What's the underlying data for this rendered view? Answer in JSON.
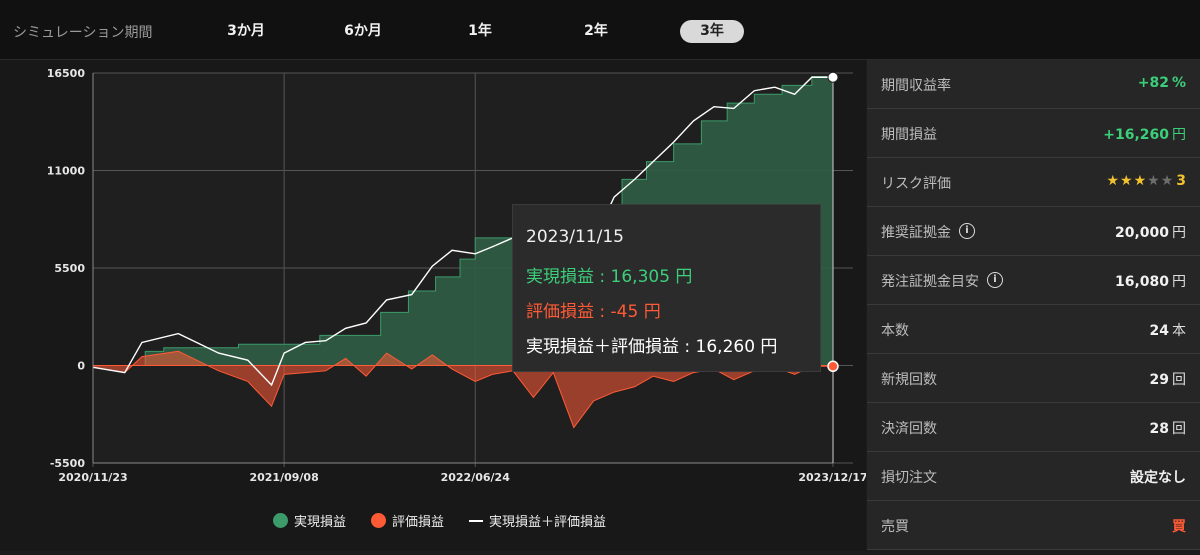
{
  "period": {
    "label": "シミュレーション期間",
    "options": [
      {
        "label": "3か月",
        "active": false
      },
      {
        "label": "6か月",
        "active": false
      },
      {
        "label": "1年",
        "active": false
      },
      {
        "label": "2年",
        "active": false
      },
      {
        "label": "3年",
        "active": true
      }
    ]
  },
  "stats": {
    "return_rate": {
      "label": "期間収益率",
      "value": "+82",
      "unit": "%"
    },
    "profit": {
      "label": "期間損益",
      "value": "+16,260",
      "unit": "円"
    },
    "risk": {
      "label": "リスク評価",
      "stars_on": 3,
      "stars_total": 5,
      "value": "3"
    },
    "recommended_margin": {
      "label": "推奨証拠金",
      "value": "20,000",
      "unit": "円"
    },
    "order_margin": {
      "label": "発注証拠金目安",
      "value": "16,080",
      "unit": "円"
    },
    "count": {
      "label": "本数",
      "value": "24",
      "unit": "本"
    },
    "new_orders": {
      "label": "新規回数",
      "value": "29",
      "unit": "回"
    },
    "settlements": {
      "label": "決済回数",
      "value": "28",
      "unit": "回"
    },
    "stop_loss": {
      "label": "損切注文",
      "value": "設定なし"
    },
    "side": {
      "label": "売買",
      "value": "買"
    }
  },
  "tooltip": {
    "date": "2023/11/15",
    "realized": "実現損益 : 16,305 円",
    "unrealized": "評価損益 : -45 円",
    "total": "実現損益＋評価損益 : 16,260 円"
  },
  "legend": {
    "realized": "実現損益",
    "unrealized": "評価損益",
    "total": "実現損益＋評価損益"
  },
  "colors": {
    "realized": "#3d9a6a",
    "realized_fill": "#2f5d45",
    "unrealized": "#ff5a36",
    "total": "#ffffff",
    "positive": "#3ccf7a",
    "negative": "#ff5a36"
  },
  "chart_data": {
    "type": "area",
    "ylim": [
      -5500,
      16500
    ],
    "yticks": [
      -5500,
      0,
      5500,
      11000,
      16500
    ],
    "ytick_labels": [
      "-5500",
      "0",
      "5500",
      "11000",
      "16500"
    ],
    "xtick_labels": [
      "2020/11/23",
      "2021/09/08",
      "2022/06/24",
      "2023/12/17"
    ],
    "xlim": [
      "2020/11/23",
      "2023/12/17"
    ],
    "grid": true,
    "series": [
      {
        "name": "実現損益",
        "x": [
          "2020/11/23",
          "2021/01/15",
          "2021/02/10",
          "2021/03/10",
          "2021/05/01",
          "2021/07/01",
          "2021/09/08",
          "2021/11/01",
          "2021/12/20",
          "2022/02/01",
          "2022/03/15",
          "2022/04/25",
          "2022/06/01",
          "2022/06/24",
          "2022/07/20",
          "2022/09/10",
          "2022/11/01",
          "2022/12/20",
          "2023/02/01",
          "2023/03/10",
          "2023/04/20",
          "2023/06/01",
          "2023/07/10",
          "2023/08/20",
          "2023/10/01",
          "2023/11/15",
          "2023/12/17"
        ],
        "values": [
          0,
          0,
          800,
          1000,
          1000,
          1200,
          1200,
          1700,
          1700,
          3000,
          4200,
          5000,
          6000,
          7200,
          7200,
          7500,
          8500,
          9000,
          10500,
          11500,
          12500,
          13800,
          14800,
          15300,
          15800,
          16305,
          16305
        ]
      },
      {
        "name": "評価損益",
        "x": [
          "2020/11/23",
          "2021/01/10",
          "2021/02/05",
          "2021/04/01",
          "2021/06/01",
          "2021/07/15",
          "2021/08/20",
          "2021/09/08",
          "2021/10/10",
          "2021/11/10",
          "2021/12/10",
          "2022/01/10",
          "2022/02/10",
          "2022/03/20",
          "2022/04/20",
          "2022/05/20",
          "2022/06/24",
          "2022/07/20",
          "2022/08/20",
          "2022/09/20",
          "2022/10/20",
          "2022/11/20",
          "2022/12/20",
          "2023/01/20",
          "2023/02/20",
          "2023/03/20",
          "2023/04/20",
          "2023/05/20",
          "2023/06/20",
          "2023/07/20",
          "2023/08/20",
          "2023/09/20",
          "2023/10/20",
          "2023/11/15",
          "2023/12/17"
        ],
        "values": [
          -100,
          -400,
          500,
          800,
          -300,
          -900,
          -2300,
          -500,
          -400,
          -300,
          400,
          -600,
          700,
          -200,
          600,
          -200,
          -900,
          -500,
          -300,
          -1800,
          -400,
          -3500,
          -2000,
          -1500,
          -1200,
          -600,
          -900,
          -400,
          -200,
          -800,
          -300,
          -100,
          -500,
          -45,
          -45
        ]
      },
      {
        "name": "実現損益＋評価損益",
        "x": [
          "2020/11/23",
          "2021/01/10",
          "2021/02/05",
          "2021/04/01",
          "2021/06/01",
          "2021/07/15",
          "2021/08/20",
          "2021/09/08",
          "2021/10/10",
          "2021/11/10",
          "2021/12/10",
          "2022/01/10",
          "2022/02/10",
          "2022/03/20",
          "2022/04/20",
          "2022/05/20",
          "2022/06/24",
          "2022/07/20",
          "2022/08/20",
          "2022/09/20",
          "2022/10/20",
          "2022/11/20",
          "2022/12/20",
          "2023/01/20",
          "2023/02/20",
          "2023/03/20",
          "2023/04/20",
          "2023/05/20",
          "2023/06/20",
          "2023/07/20",
          "2023/08/20",
          "2023/09/20",
          "2023/10/20",
          "2023/11/15",
          "2023/12/17"
        ],
        "values": [
          -100,
          -400,
          1300,
          1800,
          700,
          300,
          -1100,
          700,
          1300,
          1400,
          2100,
          2400,
          3700,
          4000,
          5600,
          6500,
          6300,
          6700,
          7200,
          5700,
          8100,
          5500,
          7000,
          9500,
          10500,
          11500,
          12600,
          13800,
          14600,
          14500,
          15500,
          15700,
          15300,
          16260,
          16260
        ]
      }
    ]
  }
}
